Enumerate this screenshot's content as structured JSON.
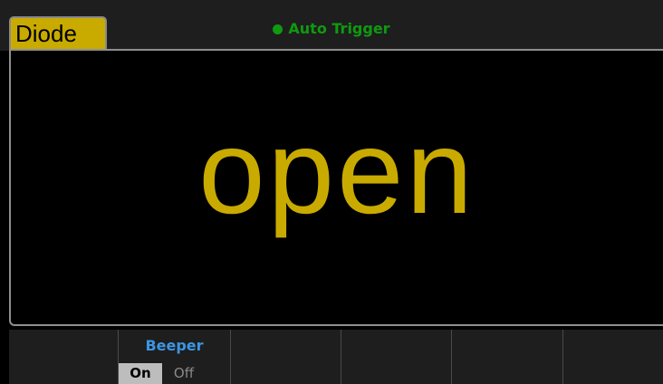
{
  "header": {
    "mode_label": "Diode",
    "trigger_label": "Auto Trigger"
  },
  "display": {
    "reading": "open"
  },
  "softkeys": [
    {
      "title": ""
    },
    {
      "title": "Beeper",
      "options": [
        "On",
        "Off"
      ],
      "selected": "On"
    },
    {
      "title": ""
    },
    {
      "title": ""
    },
    {
      "title": ""
    },
    {
      "title": ""
    }
  ],
  "colors": {
    "accent_yellow": "#c9ab00",
    "trigger_green": "#0f9a0f",
    "softkey_title_blue": "#3c95e3",
    "selected_option_bg": "#bdbdbd"
  }
}
